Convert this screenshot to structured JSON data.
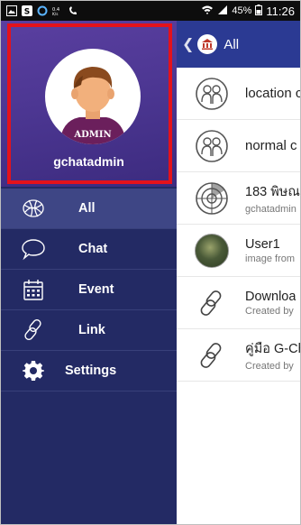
{
  "status_bar": {
    "battery": "45%",
    "time": "11:26",
    "network": "0.4 K/s"
  },
  "drawer": {
    "avatar_badge": "ADMIN",
    "username": "gchatadmin",
    "menu": [
      {
        "label": "All",
        "icon": "globe-doodle-icon",
        "active": true
      },
      {
        "label": "Chat",
        "icon": "chat-bubble-icon",
        "active": false
      },
      {
        "label": "Event",
        "icon": "calendar-icon",
        "active": false
      },
      {
        "label": "Link",
        "icon": "link-icon",
        "active": false
      },
      {
        "label": "Settings",
        "icon": "gear-icon",
        "active": false
      }
    ]
  },
  "content": {
    "title": "All",
    "rows": [
      {
        "title": "location c",
        "subtitle": "",
        "icon": "group-people-icon"
      },
      {
        "title": "normal c",
        "subtitle": "",
        "icon": "group-people-icon"
      },
      {
        "title": "183 พิษณ",
        "subtitle": "gchatadmin",
        "icon": "radar-icon"
      },
      {
        "title": "User1",
        "subtitle": "image from",
        "icon": "user-photo"
      },
      {
        "title": "Downloa",
        "subtitle": "Created by",
        "icon": "link-icon"
      },
      {
        "title": "คู่มือ G-Ch",
        "subtitle": "Created by",
        "icon": "link-icon"
      }
    ]
  },
  "colors": {
    "drawer_bg": "#232a64",
    "profile_bg": "#4d3793",
    "topbar_bg": "#2b3a93",
    "highlight_outline": "#e4121b"
  }
}
